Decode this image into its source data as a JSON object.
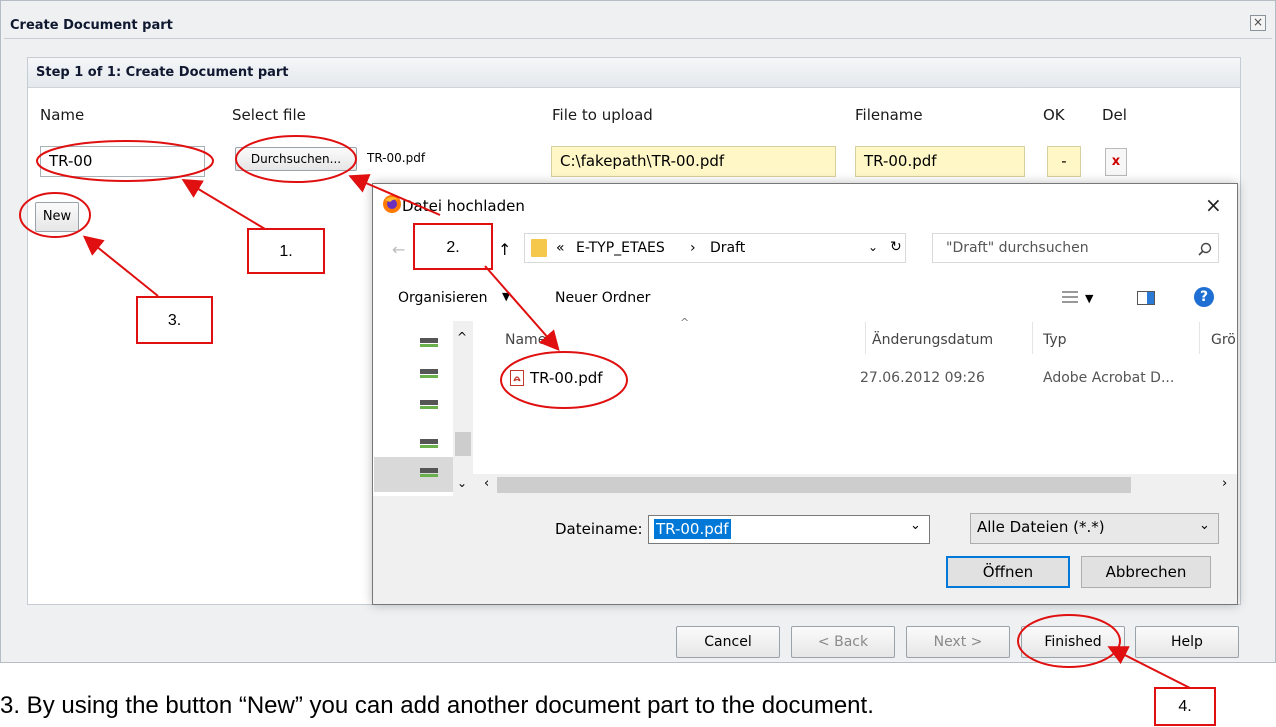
{
  "dialog": {
    "title": "Create Document part",
    "close": "×"
  },
  "step": {
    "title": "Step 1 of 1: Create Document part"
  },
  "columns": {
    "name": "Name",
    "select_file": "Select file",
    "file_to_upload": "File to upload",
    "filename": "Filename",
    "ok": "OK",
    "del": "Del"
  },
  "row": {
    "name_value": "TR-00",
    "browse_label": "Durchsuchen...",
    "selected_file": "TR-00.pdf",
    "upload_path": "C:\\fakepath\\TR-00.pdf",
    "filename_value": "TR-00.pdf",
    "ok_value": "-",
    "del_label": "x"
  },
  "new_button": "New",
  "footer_buttons": {
    "cancel": "Cancel",
    "back": "< Back",
    "next": "Next >",
    "finished": "Finished",
    "help": "Help"
  },
  "file_dialog": {
    "title": "Datei hochladen",
    "close": "×",
    "back_arrow": "←",
    "up_arrow": "↑",
    "path_prefix": "«",
    "path_parts": [
      "E-TYP_ETAES",
      "Draft"
    ],
    "path_sep": "›",
    "refresh": "↻",
    "search_placeholder": "\"Draft\" durchsuchen",
    "organize": "Organisieren",
    "new_folder": "Neuer Ordner",
    "help_icon": "?",
    "list_headers": {
      "name": "Name",
      "date": "Änderungsdatum",
      "type": "Typ",
      "size": "Grö"
    },
    "files": [
      {
        "name": "TR-00.pdf",
        "date": "27.06.2012 09:26",
        "type": "Adobe Acrobat D..."
      }
    ],
    "filename_label": "Dateiname:",
    "filename_value": "TR-00.pdf",
    "filetype_value": "Alle Dateien (*.*)",
    "open_button": "Öffnen",
    "cancel_button": "Abbrechen"
  },
  "annotations": {
    "c1": "1.",
    "c2": "2.",
    "c3": "3.",
    "c4": "4.",
    "accent": "#e01010"
  },
  "caption": "3. By using the button “New” you can add another document part to the document."
}
